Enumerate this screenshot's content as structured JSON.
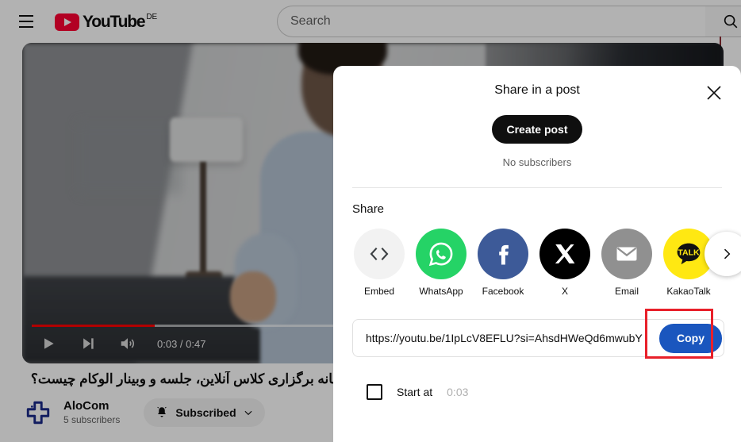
{
  "masthead": {
    "menu_icon": "hamburger-icon",
    "logo_text": "YouTube",
    "country_code": "DE",
    "search_placeholder": "Search",
    "search_value": "",
    "search_icon": "search-icon"
  },
  "player": {
    "play_icon": "play-icon",
    "next_icon": "next-track-icon",
    "volume_icon": "volume-icon",
    "current_time": "0:03",
    "duration": "0:47",
    "time_display": "0:03 / 0:47",
    "progress_percent": 18
  },
  "video": {
    "title": "سامانه برگزاری کلاس آنلاین، جلسه و وبینار الوکام چیست؟",
    "channel_name": "AloCom",
    "channel_subscribers": "5 subscribers",
    "subscribe_label": "Subscribed",
    "bell_icon": "bell-icon",
    "chevron_icon": "chevron-down-icon"
  },
  "dialog": {
    "title": "Share in a post",
    "close_icon": "close-icon",
    "create_post_label": "Create post",
    "no_subscribers": "No subscribers",
    "share_section_label": "Share",
    "targets": [
      {
        "label": "Embed",
        "icon": "embed-icon",
        "color": "#f2f2f2"
      },
      {
        "label": "WhatsApp",
        "icon": "whatsapp-icon",
        "color": "#25d366"
      },
      {
        "label": "Facebook",
        "icon": "facebook-icon",
        "color": "#3d5a98"
      },
      {
        "label": "X",
        "icon": "x-icon",
        "color": "#000000"
      },
      {
        "label": "Email",
        "icon": "email-icon",
        "color": "#909090"
      },
      {
        "label": "KakaoTalk",
        "icon": "kakaotalk-icon",
        "color": "#ffe812"
      }
    ],
    "scroll_next_icon": "chevron-right-icon",
    "link_url": "https://youtu.be/1IpLcV8EFLU?si=AhsdHWeQd6mwubY",
    "copy_label": "Copy",
    "copy_button_color": "#1a56be",
    "highlight_color": "#e8202a",
    "start_at_label": "Start at",
    "start_at_time": "0:03",
    "start_at_checked": false
  }
}
